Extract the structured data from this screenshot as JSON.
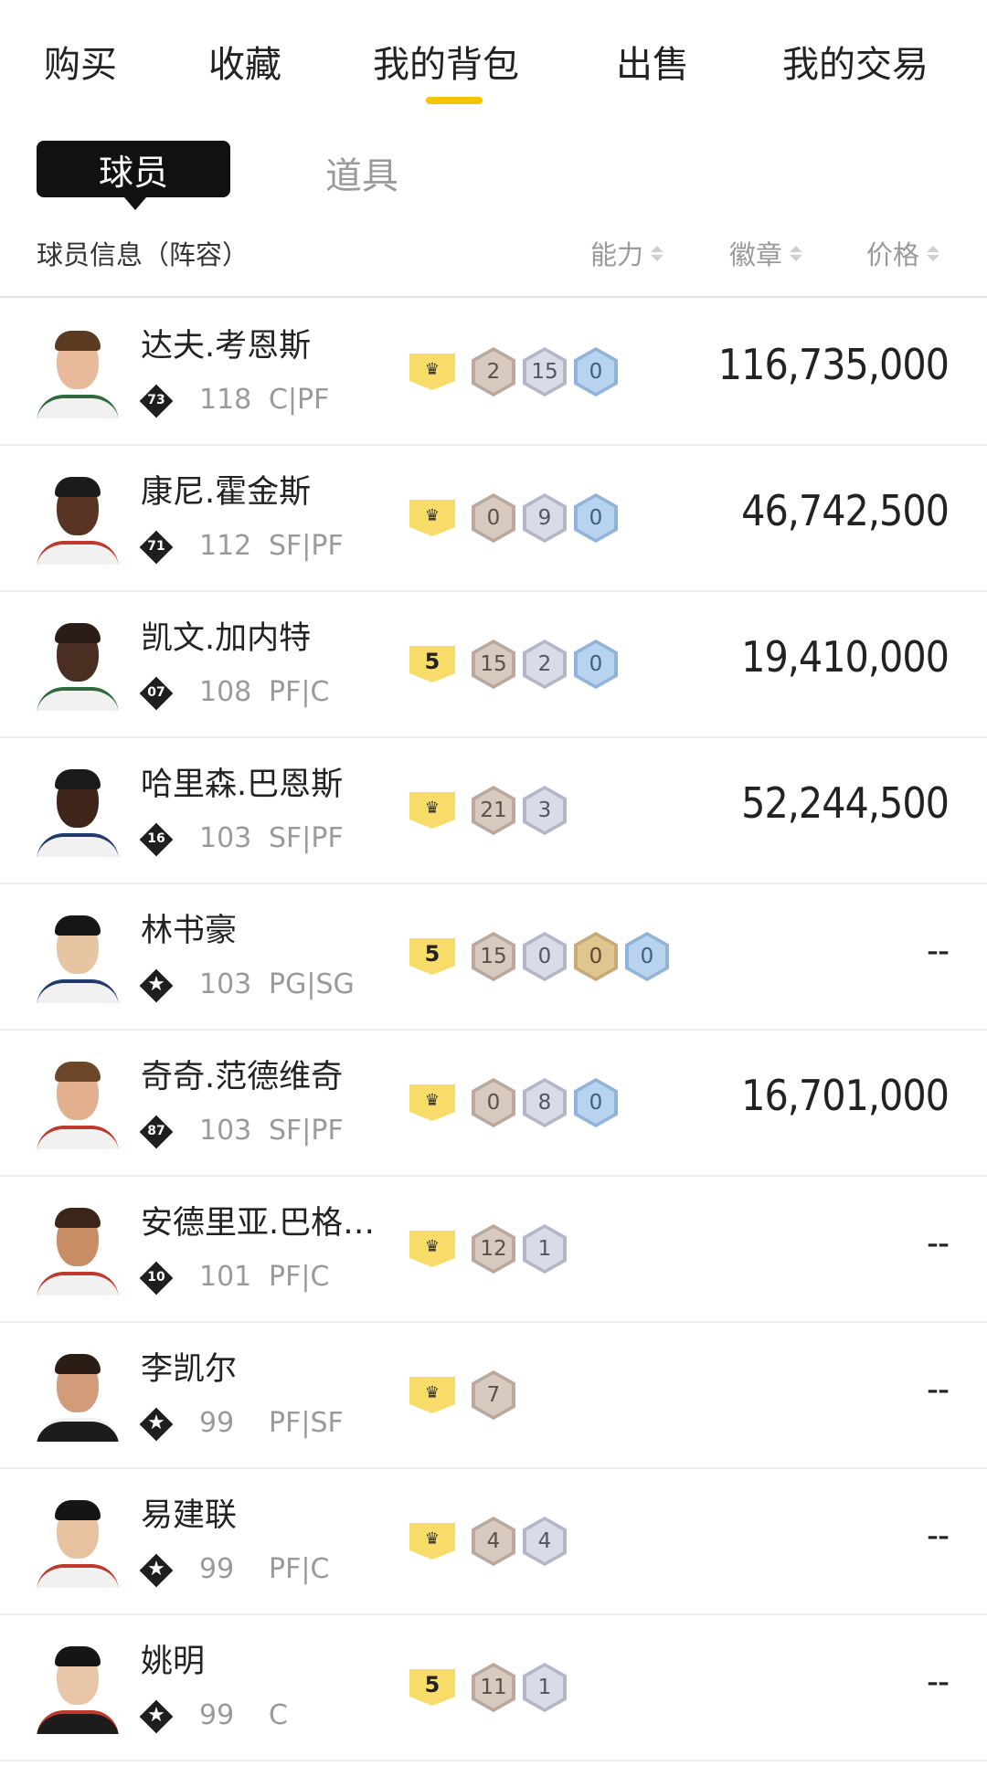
{
  "nav": {
    "tabs": [
      "购买",
      "收藏",
      "我的背包",
      "出售",
      "我的交易"
    ],
    "active_index": 2,
    "accent_color": "#f5c400"
  },
  "subtabs": {
    "active": "球员",
    "inactive": "道具"
  },
  "columns": {
    "info": "球员信息（阵容）",
    "ability": "能力",
    "badges": "徽章",
    "price": "价格"
  },
  "players": [
    {
      "name": "达夫.考恩斯",
      "tier": "73",
      "ovr": "118",
      "pos": "C|PF",
      "lead": {
        "type": "crown",
        "label": "♛"
      },
      "badges": [
        {
          "c": "bronze",
          "v": "2"
        },
        {
          "c": "silver",
          "v": "15"
        },
        {
          "c": "blue",
          "v": "0"
        }
      ],
      "price": "116,735,000"
    },
    {
      "name": "康尼.霍金斯",
      "tier": "71",
      "ovr": "112",
      "pos": "SF|PF",
      "lead": {
        "type": "crown",
        "label": "♛"
      },
      "badges": [
        {
          "c": "bronze",
          "v": "0"
        },
        {
          "c": "silver",
          "v": "9"
        },
        {
          "c": "blue",
          "v": "0"
        }
      ],
      "price": "46,742,500"
    },
    {
      "name": "凯文.加内特",
      "tier": "07",
      "ovr": "108",
      "pos": "PF|C",
      "lead": {
        "type": "level",
        "label": "5"
      },
      "badges": [
        {
          "c": "bronze",
          "v": "15"
        },
        {
          "c": "silver",
          "v": "2"
        },
        {
          "c": "blue",
          "v": "0"
        }
      ],
      "price": "19,410,000"
    },
    {
      "name": "哈里森.巴恩斯",
      "tier": "16",
      "ovr": "103",
      "pos": "SF|PF",
      "lead": {
        "type": "crown",
        "label": "♛"
      },
      "badges": [
        {
          "c": "bronze",
          "v": "21"
        },
        {
          "c": "silver",
          "v": "3"
        }
      ],
      "price": "52,244,500"
    },
    {
      "name": "林书豪",
      "tier": "★",
      "ovr": "103",
      "pos": "PG|SG",
      "lead": {
        "type": "level",
        "label": "5"
      },
      "badges": [
        {
          "c": "bronze",
          "v": "15"
        },
        {
          "c": "silver",
          "v": "0"
        },
        {
          "c": "gold",
          "v": "0"
        },
        {
          "c": "blue",
          "v": "0"
        }
      ],
      "price": "--"
    },
    {
      "name": "奇奇.范德维奇",
      "tier": "87",
      "ovr": "103",
      "pos": "SF|PF",
      "lead": {
        "type": "crown",
        "label": "♛"
      },
      "badges": [
        {
          "c": "bronze",
          "v": "0"
        },
        {
          "c": "silver",
          "v": "8"
        },
        {
          "c": "blue",
          "v": "0"
        }
      ],
      "price": "16,701,000"
    },
    {
      "name": "安德里亚.巴格…",
      "tier": "10",
      "ovr": "101",
      "pos": "PF|C",
      "lead": {
        "type": "crown",
        "label": "♛"
      },
      "badges": [
        {
          "c": "bronze",
          "v": "12"
        },
        {
          "c": "silver",
          "v": "1"
        }
      ],
      "price": "--"
    },
    {
      "name": "李凯尔",
      "tier": "★",
      "ovr": "99",
      "pos": "PF|SF",
      "lead": {
        "type": "crown",
        "label": "♛"
      },
      "badges": [
        {
          "c": "bronze",
          "v": "7"
        }
      ],
      "price": "--"
    },
    {
      "name": "易建联",
      "tier": "★",
      "ovr": "99",
      "pos": "PF|C",
      "lead": {
        "type": "crown",
        "label": "♛"
      },
      "badges": [
        {
          "c": "bronze",
          "v": "4"
        },
        {
          "c": "silver",
          "v": "4"
        }
      ],
      "price": "--"
    },
    {
      "name": "姚明",
      "tier": "★",
      "ovr": "99",
      "pos": "C",
      "lead": {
        "type": "level",
        "label": "5"
      },
      "badges": [
        {
          "c": "bronze",
          "v": "11"
        },
        {
          "c": "silver",
          "v": "1"
        }
      ],
      "price": "--"
    }
  ],
  "avatars": [
    {
      "skin": "#e8b99a",
      "hair": "#5b3a22",
      "jersey": "#f1f1f1",
      "trim": "#2f6b3a"
    },
    {
      "skin": "#5a3422",
      "hair": "#1b1b1b",
      "jersey": "#f1f1f1",
      "trim": "#c0392b"
    },
    {
      "skin": "#4a2e22",
      "hair": "#2a1c16",
      "jersey": "#f1f1f1",
      "trim": "#2f6b3a"
    },
    {
      "skin": "#3e2419",
      "hair": "#1a1a1a",
      "jersey": "#f1f1f1",
      "trim": "#1f3b6e"
    },
    {
      "skin": "#e7c4a2",
      "hair": "#161616",
      "jersey": "#f1f1f1",
      "trim": "#1f3b6e"
    },
    {
      "skin": "#e3b08f",
      "hair": "#6b4628",
      "jersey": "#f1f1f1",
      "trim": "#c0392b"
    },
    {
      "skin": "#c98d66",
      "hair": "#3b2418",
      "jersey": "#f1f1f1",
      "trim": "#c0392b"
    },
    {
      "skin": "#d29c7a",
      "hair": "#2b1d15",
      "jersey": "#1c1c1c",
      "trim": "#f1f1f1"
    },
    {
      "skin": "#e7c2a0",
      "hair": "#151515",
      "jersey": "#f1f1f1",
      "trim": "#c0392b"
    },
    {
      "skin": "#e9c6a8",
      "hair": "#151515",
      "jersey": "#1c1c1c",
      "trim": "#c0392b"
    }
  ]
}
